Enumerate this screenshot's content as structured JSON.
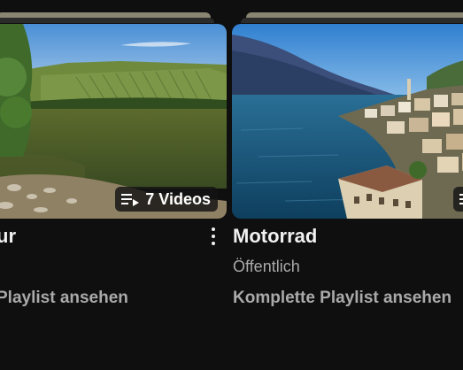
{
  "playlists": [
    {
      "title_fragment": "ur",
      "video_count_label": "7 Videos",
      "link_fragment": "Playlist ansehen"
    },
    {
      "title": "Motorrad",
      "visibility": "Öffentlich",
      "link": "Komplette Playlist ansehen"
    }
  ],
  "icons": {
    "playlist_badge": "playlist-icon",
    "more_menu": "more-vert-icon"
  },
  "colors": {
    "background": "#0f0f0f",
    "title": "#f1f1f1",
    "secondary_text": "#aaaaaa"
  }
}
